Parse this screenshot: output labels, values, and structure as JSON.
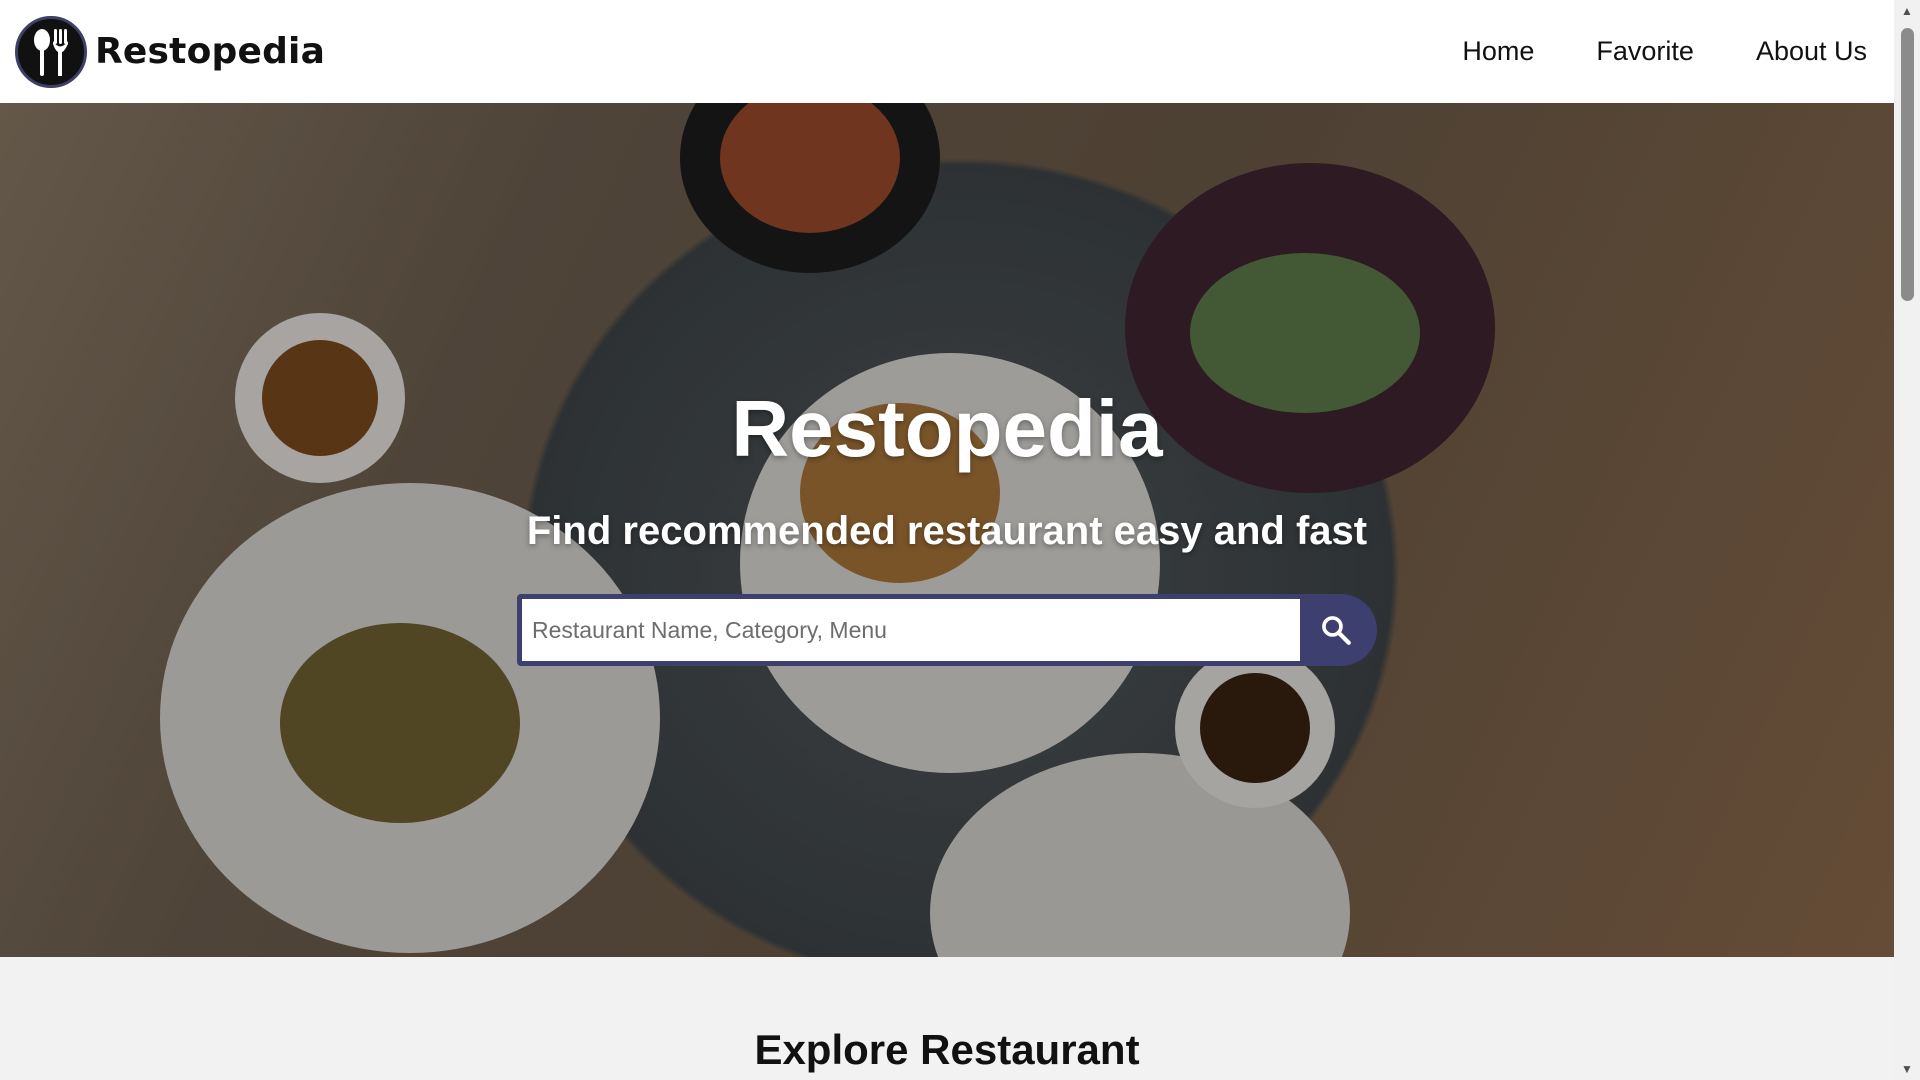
{
  "header": {
    "brand_name": "Restopedia",
    "nav": [
      {
        "label": "Home"
      },
      {
        "label": "Favorite"
      },
      {
        "label": "About Us"
      }
    ]
  },
  "hero": {
    "title": "Restopedia",
    "subtitle": "Find recommended restaurant easy and fast",
    "search": {
      "placeholder": "Restaurant Name, Category, Menu",
      "value": ""
    }
  },
  "explore": {
    "title": "Explore Restaurant"
  },
  "icons": {
    "logo": "spoon-fork-logo-icon",
    "search": "search-icon",
    "scroll_up": "scroll-up-arrow-icon",
    "scroll_down": "scroll-down-arrow-icon"
  },
  "colors": {
    "accent": "#3d3f6e",
    "header_bg": "#ffffff",
    "page_bg": "#f2f2f2"
  }
}
